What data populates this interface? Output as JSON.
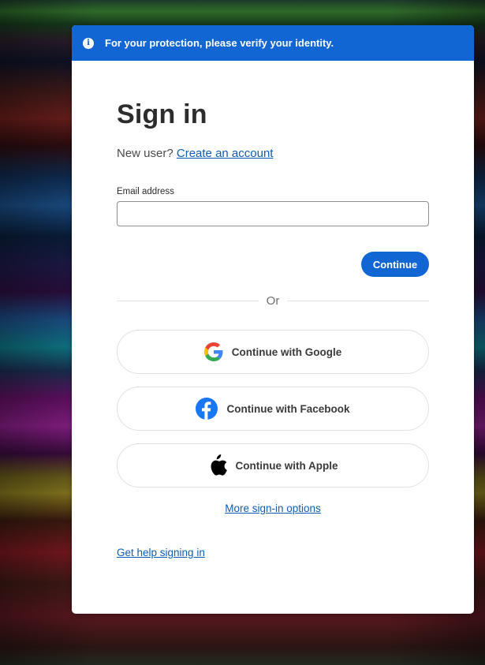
{
  "banner": {
    "icon": "info-icon",
    "message": "For your protection, please verify your identity."
  },
  "signin": {
    "title": "Sign in",
    "new_user_text": "New user?",
    "create_account_link": "Create an account",
    "email_label": "Email address",
    "email_value": "",
    "continue_label": "Continue",
    "or_text": "Or",
    "social": {
      "google_label": "Continue with Google",
      "facebook_label": "Continue with Facebook",
      "apple_label": "Continue with Apple"
    },
    "more_options_link": "More sign-in options",
    "help_link": "Get help signing in"
  },
  "colors": {
    "accent": "#1166d3",
    "link": "#0d5cb6",
    "facebook": "#1877f2",
    "google_blue": "#4285F4",
    "google_red": "#EA4335",
    "google_yellow": "#FBBC05",
    "google_green": "#34A853"
  }
}
